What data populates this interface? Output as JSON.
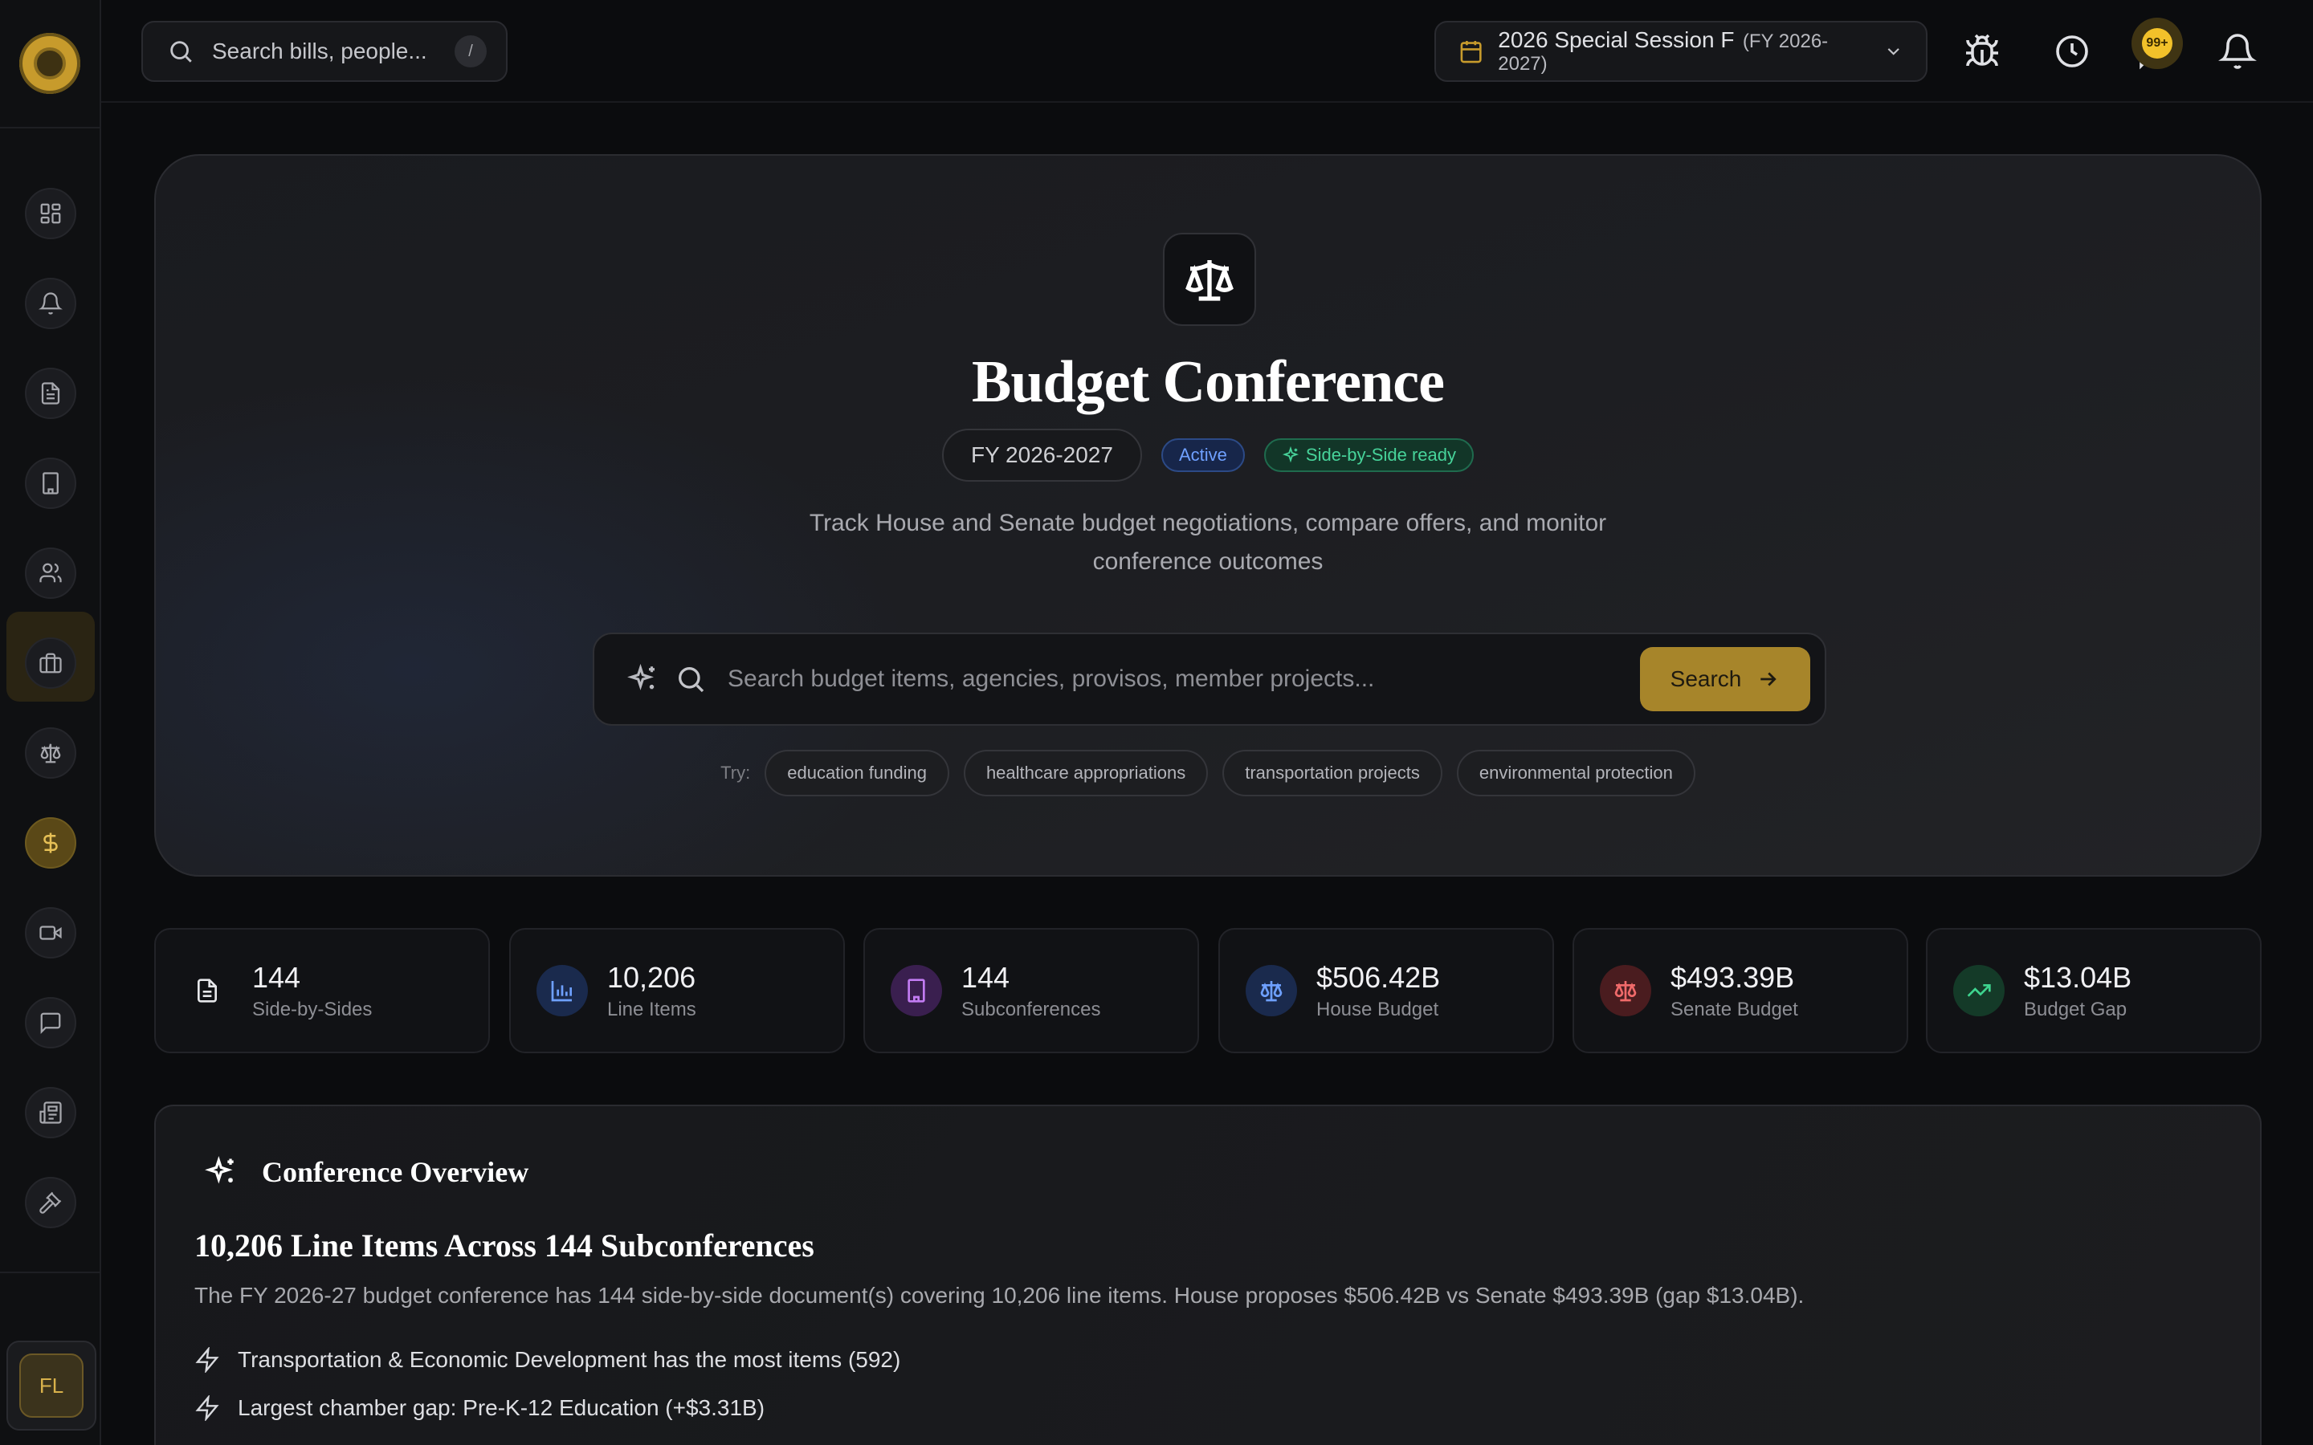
{
  "topbar": {
    "search_placeholder": "Search bills, people...",
    "search_shortcut": "/",
    "session_name": "2026 Special Session F",
    "session_fy": "(FY 2026-2027)",
    "notifications_badge": "99+"
  },
  "sidebar": {
    "items": [
      {
        "icon": "dashboard-icon"
      },
      {
        "icon": "bell-icon"
      },
      {
        "icon": "document-icon"
      },
      {
        "icon": "building-icon"
      },
      {
        "icon": "users-icon"
      },
      {
        "icon": "briefcase-icon"
      },
      {
        "icon": "scale-icon"
      },
      {
        "icon": "dollar-icon",
        "active": true
      },
      {
        "icon": "video-icon"
      },
      {
        "icon": "chat-icon"
      },
      {
        "icon": "newspaper-icon"
      },
      {
        "icon": "gavel-icon"
      }
    ],
    "user_initials": "FL"
  },
  "hero": {
    "title": "Budget Conference",
    "fy_label": "FY 2026-2027",
    "status_badge": "Active",
    "ready_badge": "Side-by-Side ready",
    "subtitle_line1": "Track House and Senate budget negotiations, compare offers, and monitor",
    "subtitle_line2": "conference outcomes",
    "search_placeholder": "Search budget items, agencies, provisos, member projects...",
    "search_button": "Search",
    "try_label": "Try:",
    "suggestions": [
      "education funding",
      "healthcare appropriations",
      "transportation projects",
      "environmental protection"
    ]
  },
  "stats": [
    {
      "value": "144",
      "label": "Side-by-Sides",
      "icon": "document-icon"
    },
    {
      "value": "10,206",
      "label": "Line Items",
      "icon": "bar-chart-icon"
    },
    {
      "value": "144",
      "label": "Subconferences",
      "icon": "building-icon"
    },
    {
      "value": "$506.42B",
      "label": "House Budget",
      "icon": "scale-icon"
    },
    {
      "value": "$493.39B",
      "label": "Senate Budget",
      "icon": "scale-icon"
    },
    {
      "value": "$13.04B",
      "label": "Budget Gap",
      "icon": "trending-up-icon"
    }
  ],
  "overview": {
    "title": "Conference Overview",
    "heading": "10,206 Line Items Across 144 Subconferences",
    "summary": "The FY 2026-27 budget conference has 144 side-by-side document(s) covering 10,206 line items. House proposes $506.42B vs Senate $493.39B (gap $13.04B).",
    "bullets": [
      "Transportation & Economic Development has the most items (592)",
      "Largest chamber gap: Pre-K-12 Education (+$3.31B)"
    ]
  },
  "colors": {
    "accent_gold": "#a7852a",
    "active_blue": "#6fa0ff",
    "ready_green": "#47d39a"
  }
}
